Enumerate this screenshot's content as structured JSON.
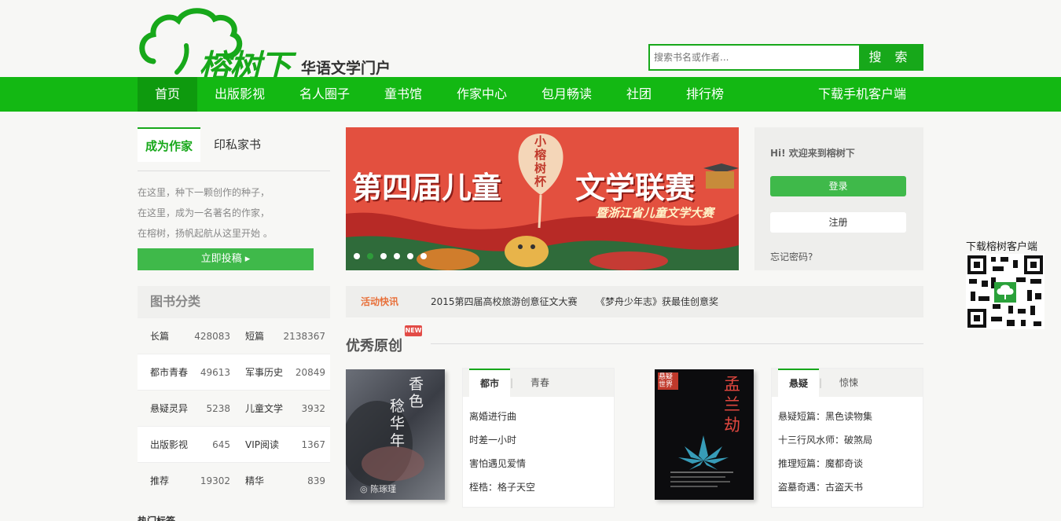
{
  "logo": {
    "brand": "榕树下",
    "slogan": "华语文学门户"
  },
  "search": {
    "placeholder": "搜索书名或作者...",
    "button_label": "搜 索"
  },
  "nav": {
    "items": [
      {
        "label": "首页"
      },
      {
        "label": "出版影视"
      },
      {
        "label": "名人圈子"
      },
      {
        "label": "童书馆"
      },
      {
        "label": "作家中心"
      },
      {
        "label": "包月畅读"
      },
      {
        "label": "社团"
      },
      {
        "label": "排行榜"
      }
    ],
    "download": "下载手机客户端"
  },
  "writer_tabs": {
    "active": "成为作家",
    "other": "印私家书"
  },
  "intro": [
    "在这里，种下一颗创作的种子，",
    "在这里，成为一名著名的作家，",
    "在榕树，扬帆起航从这里开始 。"
  ],
  "submit_button": "立即投稿 ▸",
  "categories": {
    "title": "图书分类",
    "rows": [
      {
        "n1": "长篇",
        "v1": "428083",
        "n2": "短篇",
        "v2": "2138367"
      },
      {
        "n1": "都市青春",
        "v1": "49613",
        "n2": "军事历史",
        "v2": "20849"
      },
      {
        "n1": "悬疑灵异",
        "v1": "5238",
        "n2": "儿童文学",
        "v2": "3932"
      },
      {
        "n1": "出版影视",
        "v1": "645",
        "n2": "VIP阅读",
        "v2": "1367"
      },
      {
        "n1": "推荐",
        "v1": "19302",
        "n2": "精华",
        "v2": "839"
      }
    ]
  },
  "hot_tags": "热门标签",
  "banner": {
    "title_left": "第四届儿童",
    "title_right": "文学联赛",
    "balloon": [
      "小",
      "榕",
      "树",
      "杯"
    ],
    "subtitle": "暨浙江省儿童文学大赛"
  },
  "news": {
    "label": "活动快讯",
    "items": [
      "2015第四届高校旅游创意征文大赛",
      "《梦舟少年志》获最佳创意奖"
    ]
  },
  "section": {
    "title": "优秀原创",
    "badge": "NEW"
  },
  "book1": {
    "cover_title": "香色",
    "cover_sub": "稔华年",
    "cover_author": "◎ 陈琢瑾",
    "tab_active": "都市",
    "tab_other": "青春",
    "items": [
      "离婚进行曲",
      "时差一小时",
      "害怕遇见爱情",
      "桎梏：格子天空"
    ]
  },
  "book2": {
    "cover_title": "孟兰劫",
    "cover_corner": "悬疑世界",
    "tab_active": "悬疑",
    "tab_other": "惊悚",
    "items": [
      "悬疑短篇：黑色读物集",
      "十三行风水师：破煞局",
      "推理短篇：魔都奇谈",
      "盗墓奇遇：古盗天书"
    ]
  },
  "login": {
    "welcome": "Hi! 欢迎来到榕树下",
    "login": "登录",
    "register": "注册",
    "forgot": "忘记密码?"
  },
  "qr_label": "下载榕树客户端",
  "colors": {
    "brand_green": "#13b813",
    "button_green": "#3fb94a",
    "accent_orange": "#e8703a",
    "banner_red": "#e3503f"
  }
}
